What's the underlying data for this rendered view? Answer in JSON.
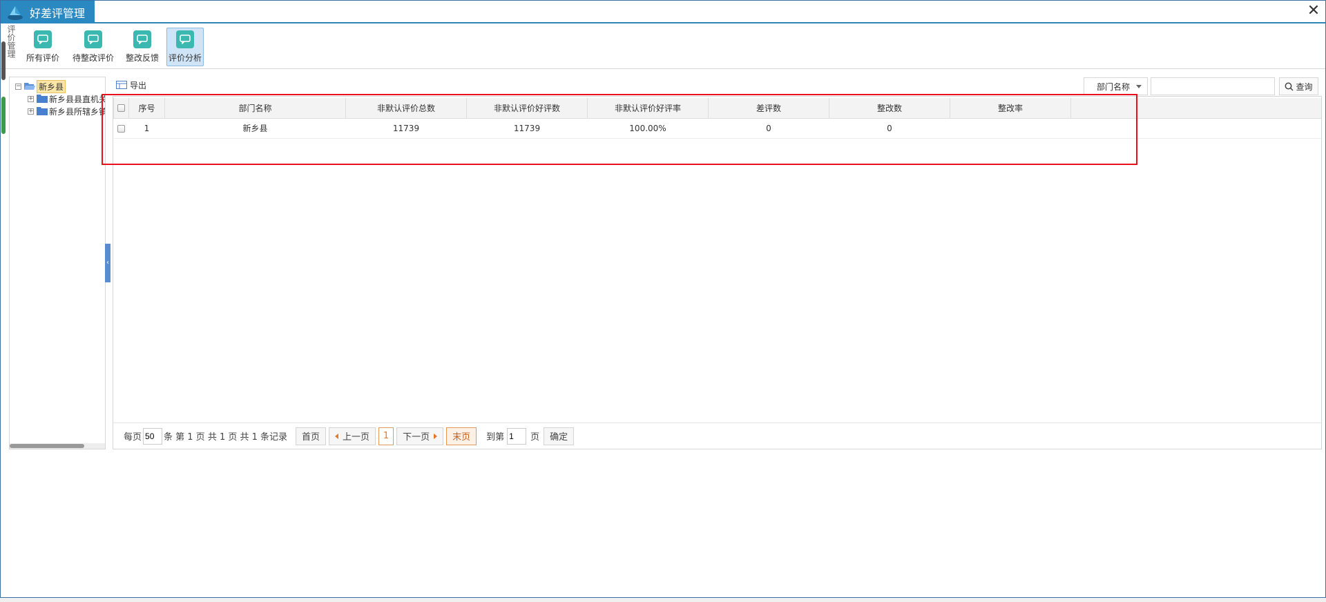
{
  "window": {
    "title": "好差评管理",
    "close_glyph": "✕"
  },
  "toolbar": {
    "section_label": "评价管理",
    "buttons": [
      {
        "label": "所有评价",
        "icon": "comment-icon"
      },
      {
        "label": "待整改评价",
        "icon": "comment-icon"
      },
      {
        "label": "整改反馈",
        "icon": "comment-icon"
      },
      {
        "label": "评价分析",
        "icon": "comment-icon",
        "active": true
      }
    ]
  },
  "tree": {
    "root": {
      "label": "新乡县",
      "toggle": "−"
    },
    "children": [
      {
        "label": "新乡县县直机关",
        "toggle": "+"
      },
      {
        "label": "新乡县所辖乡镇",
        "toggle": "+"
      }
    ]
  },
  "actions": {
    "export_label": "导出"
  },
  "search": {
    "field_selected": "部门名称",
    "input_value": "",
    "button_label": "查询"
  },
  "grid": {
    "columns": [
      "序号",
      "部门名称",
      "非默认评价总数",
      "非默认评价好评数",
      "非默认评价好评率",
      "差评数",
      "整改数",
      "整改率"
    ],
    "rows": [
      [
        "1",
        "新乡县",
        "11739",
        "11739",
        "100.00%",
        "0",
        "0",
        ""
      ]
    ]
  },
  "pager": {
    "per_page_prefix": "每页",
    "per_page_value": "50",
    "summary": "条 第 1 页 共 1 页 共 1 条记录",
    "first_label": "首页",
    "prev_label": "上一页",
    "current_page": "1",
    "next_label": "下一页",
    "last_label": "末页",
    "goto_prefix": "到第",
    "goto_value": "1",
    "goto_suffix": "页",
    "confirm_label": "确定"
  },
  "colors": {
    "title_bg": "#2a89c0",
    "tool_icon": "#3bb8b0",
    "highlight": "#e8101a",
    "pager_accent": "#e07a2c"
  }
}
